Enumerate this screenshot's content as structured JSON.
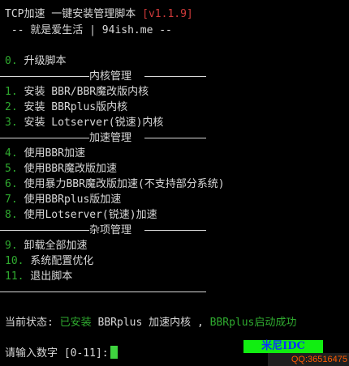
{
  "header": {
    "title": "TCP加速 一键安装管理脚本",
    "version": "[v1.1.9]",
    "subtitle": " -- 就是爱生活 | 94ish.me --"
  },
  "menu": {
    "top_item": {
      "num": "0.",
      "label": " 升级脚本"
    },
    "section1": "内核管理",
    "items1": [
      {
        "num": "1.",
        "label": " 安装 BBR/BBR魔改版内核"
      },
      {
        "num": "2.",
        "label": " 安装 BBRplus版内核"
      },
      {
        "num": "3.",
        "label": " 安装 Lotserver(锐速)内核"
      }
    ],
    "section2": "加速管理",
    "items2": [
      {
        "num": "4.",
        "label": " 使用BBR加速"
      },
      {
        "num": "5.",
        "label": " 使用BBR魔改版加速"
      },
      {
        "num": "6.",
        "label": " 使用暴力BBR魔改版加速(不支持部分系统)"
      },
      {
        "num": "7.",
        "label": " 使用BBRplus版加速"
      },
      {
        "num": "8.",
        "label": " 使用Lotserver(锐速)加速"
      }
    ],
    "section3": "杂项管理",
    "items3": [
      {
        "num": "9.",
        "label": " 卸载全部加速"
      },
      {
        "num": "10.",
        "label": " 系统配置优化"
      },
      {
        "num": "11.",
        "label": " 退出脚本"
      }
    ]
  },
  "status": {
    "prefix": "当前状态: ",
    "installed": "已安装",
    "kernel": " BBRplus 加速内核 , ",
    "running": "BBRplus启动成功"
  },
  "prompt": {
    "text": "请输入数字 [0-11]:"
  },
  "watermark": {
    "brand": "米尼IDC",
    "qq": "QQ:36516475"
  },
  "colors": {
    "background": "#000000",
    "text": "#d8d8d8",
    "number": "#2faa2f",
    "version": "#d03a3a",
    "cursor": "#3fd33f"
  }
}
